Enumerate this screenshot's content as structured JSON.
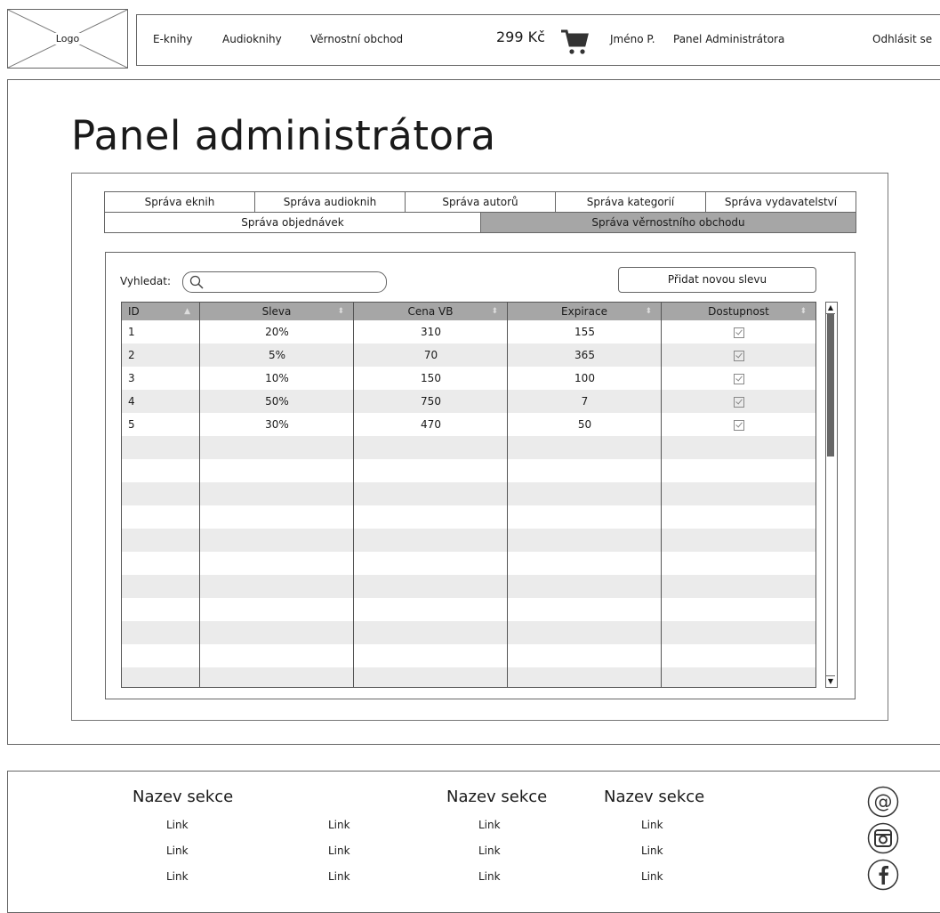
{
  "header": {
    "logo": "Logo",
    "nav": [
      "E-knihy",
      "Audioknihy",
      "Věrnostní obchod"
    ],
    "price": "299 Kč",
    "user": "Jméno P.",
    "admin_link": "Panel Administrátora",
    "logout": "Odhlásit se",
    "icons": [
      "cart-icon"
    ]
  },
  "page": {
    "title": "Panel administrátora"
  },
  "tabs_row1": [
    "Správa eknih",
    "Správa audioknih",
    "Správa autorů",
    "Správa kategorií",
    "Správa vydavatelství"
  ],
  "tabs_row2": [
    "Správa objednávek",
    "Správa věrnostního obchodu"
  ],
  "active_tab": "Správa věrnostního obchodu",
  "toolbar": {
    "search_label": "Vyhledat:",
    "search_value": "",
    "add_button": "Přidat novou slevu"
  },
  "table": {
    "columns": [
      "ID",
      "Sleva",
      "Cena VB",
      "Expirace",
      "Dostupnost"
    ],
    "rows": [
      {
        "id": "1",
        "sleva": "20%",
        "cena": "310",
        "expirace": "155",
        "dostupnost": true
      },
      {
        "id": "2",
        "sleva": "5%",
        "cena": "70",
        "expirace": "365",
        "dostupnost": true
      },
      {
        "id": "3",
        "sleva": "10%",
        "cena": "150",
        "expirace": "100",
        "dostupnost": true
      },
      {
        "id": "4",
        "sleva": "50%",
        "cena": "750",
        "expirace": "7",
        "dostupnost": true
      },
      {
        "id": "5",
        "sleva": "30%",
        "cena": "470",
        "expirace": "50",
        "dostupnost": true
      }
    ]
  },
  "footer": {
    "sections": [
      "Nazev sekce",
      "Nazev sekce",
      "Nazev sekce"
    ],
    "link_label": "Link",
    "social_icons": [
      "at-icon",
      "instagram-icon",
      "facebook-icon"
    ]
  },
  "colors": {
    "header_row": "#a6a6a6",
    "active_tab": "#a6a6a6",
    "alt_row": "#ebebeb",
    "border": "#666666"
  }
}
